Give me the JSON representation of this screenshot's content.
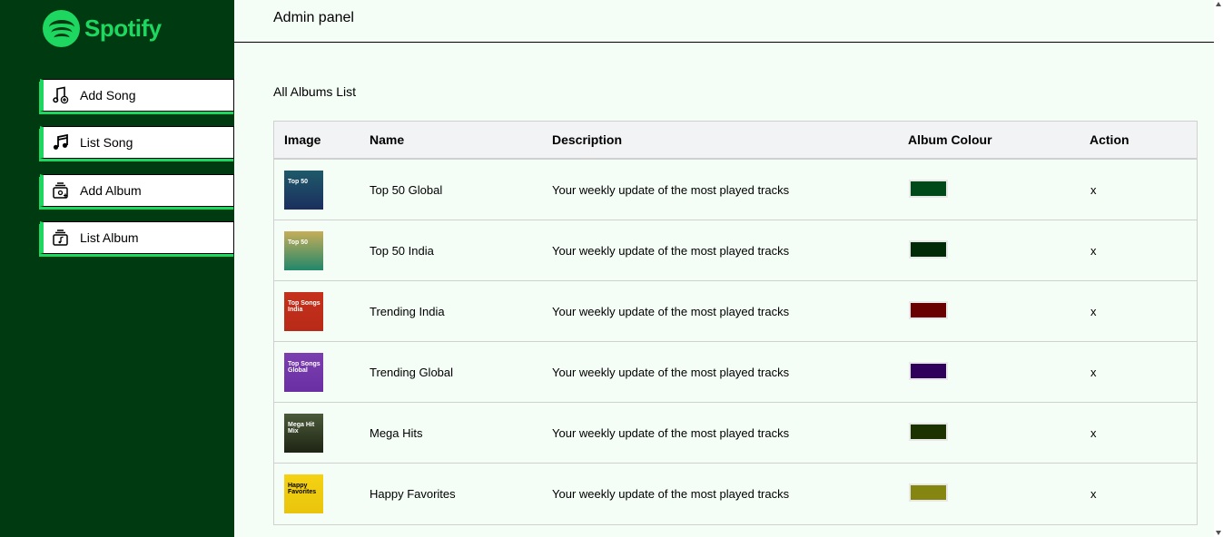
{
  "brand": {
    "name": "Spotify",
    "color": "#1ed760",
    "sidebar_bg": "#003a10"
  },
  "sidebar": {
    "items": [
      {
        "label": "Add Song",
        "icon": "add-music-icon"
      },
      {
        "label": "List Song",
        "icon": "music-note-icon"
      },
      {
        "label": "Add Album",
        "icon": "add-album-icon"
      },
      {
        "label": "List Album",
        "icon": "album-list-icon"
      }
    ]
  },
  "header": {
    "title": "Admin panel"
  },
  "main": {
    "section_title": "All Albums List",
    "columns": [
      "Image",
      "Name",
      "Description",
      "Album Colour",
      "Action"
    ],
    "rows": [
      {
        "thumb_text": "Top 50",
        "thumb_bg": "linear-gradient(180deg,#1e5a6a,#1b2f5e)",
        "name": "Top 50 Global",
        "description": "Your weekly update of the most played tracks",
        "colour": "#004a1a",
        "action": "x"
      },
      {
        "thumb_text": "Top 50",
        "thumb_bg": "linear-gradient(180deg,#c6ad58,#21876a)",
        "name": "Top 50 India",
        "description": "Your weekly update of the most played tracks",
        "colour": "#002b06",
        "action": "x"
      },
      {
        "thumb_text": "Top Songs India",
        "thumb_bg": "linear-gradient(180deg,#c5311c,#b82a17)",
        "name": "Trending India",
        "description": "Your weekly update of the most played tracks",
        "colour": "#680000",
        "action": "x"
      },
      {
        "thumb_text": "Top Songs Global",
        "thumb_bg": "linear-gradient(180deg,#7b3fb0,#6a2fa3)",
        "name": "Trending Global",
        "description": "Your weekly update of the most played tracks",
        "colour": "#2e005c",
        "action": "x"
      },
      {
        "thumb_text": "Mega Hit Mix",
        "thumb_bg": "linear-gradient(180deg,#4b5a3a,#1e2414)",
        "name": "Mega Hits",
        "description": "Your weekly update of the most played tracks",
        "colour": "#1c3300",
        "action": "x"
      },
      {
        "thumb_text": "Happy Favorites",
        "thumb_bg": "linear-gradient(180deg,#f5d213,#e9c40c)",
        "name": "Happy Favorites",
        "description": "Your weekly update of the most played tracks",
        "colour": "#858512",
        "action": "x"
      }
    ]
  }
}
